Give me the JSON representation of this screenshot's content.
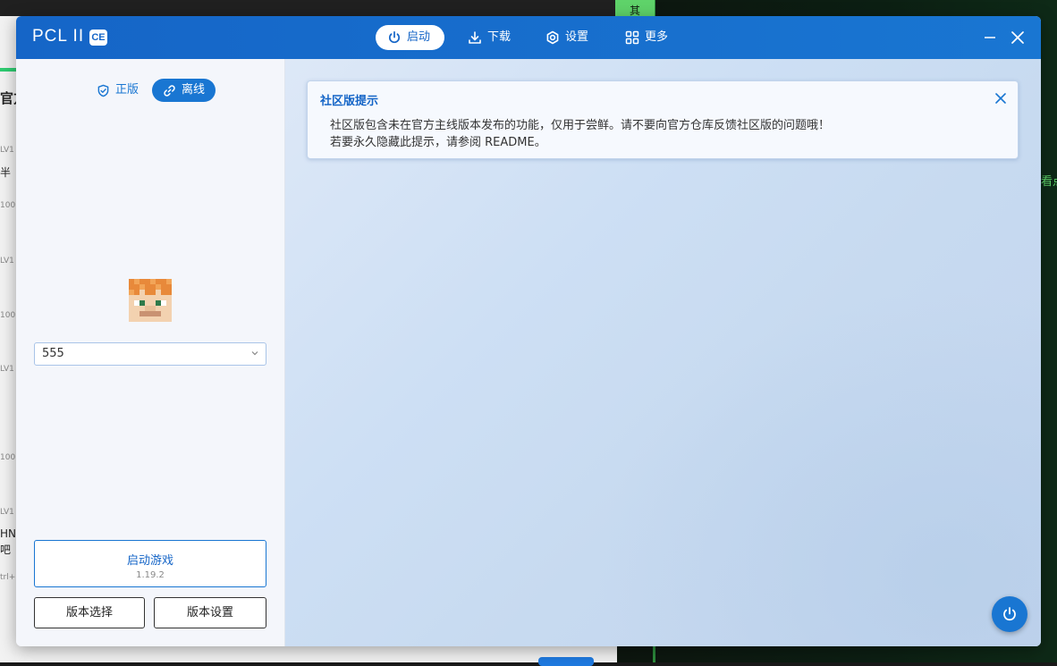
{
  "background": {
    "top_tab": "其",
    "right_text": "看点",
    "left_snippets": [
      "官方",
      "半",
      "LV",
      "HN",
      "吧",
      "trl+"
    ],
    "left_small": [
      "LV1",
      "100",
      "LV1",
      "100",
      "LV1",
      "100",
      "LV1"
    ]
  },
  "window": {
    "app_title": "PCL II",
    "badge": "CE",
    "nav": [
      {
        "label": "启动",
        "icon": "power-icon",
        "active": true
      },
      {
        "label": "下载",
        "icon": "download-icon",
        "active": false
      },
      {
        "label": "设置",
        "icon": "gear-icon",
        "active": false
      },
      {
        "label": "更多",
        "icon": "grid-icon",
        "active": false
      }
    ]
  },
  "sidebar": {
    "mode_official": "正版",
    "mode_offline": "离线",
    "username": "555",
    "launch_title": "启动游戏",
    "launch_version": "1.19.2",
    "version_select": "版本选择",
    "version_settings": "版本设置"
  },
  "notice": {
    "title": "社区版提示",
    "line1": "社区版包含未在官方主线版本发布的功能，仅用于尝鲜。请不要向官方仓库反馈社区版的问题哦！",
    "line2": "若要永久隐藏此提示，请参阅 README。"
  },
  "colors": {
    "accent": "#1976d2",
    "titlebar": "#1565c7",
    "sidebar_bg": "#f4f6fb",
    "main_bg": "#cddff4"
  }
}
